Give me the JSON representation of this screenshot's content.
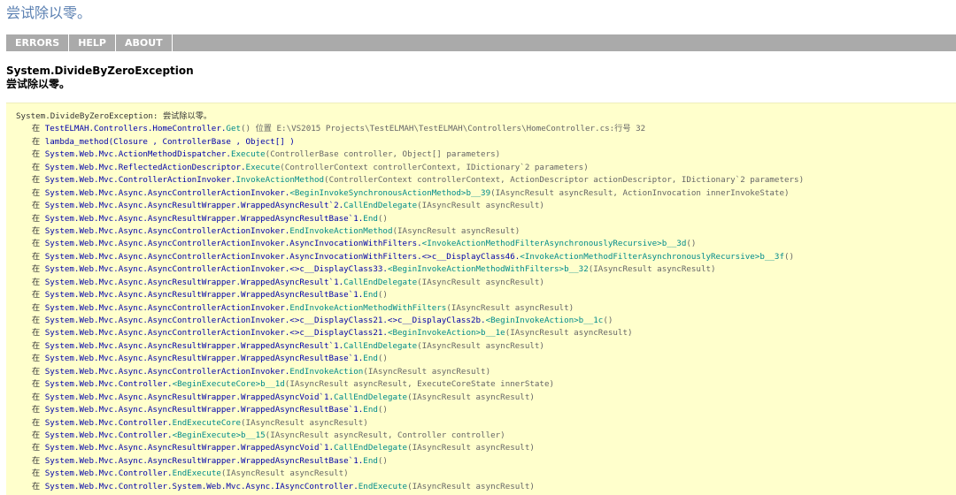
{
  "page": {
    "title": "尝试除以零。"
  },
  "nav": {
    "items": [
      "ERRORS",
      "HELP",
      "ABOUT"
    ]
  },
  "error": {
    "type": "System.DivideByZeroException",
    "message": "尝试除以零。"
  },
  "stack": {
    "first_line": "System.DivideByZeroException: 尝试除以零。",
    "at_word": "在",
    "frames": [
      {
        "cls": "TestELMAH.Controllers.HomeController.",
        "method": "Get",
        "args": "() 位置 E:\\VS2015 Projects\\TestELMAH\\TestELMAH\\Controllers\\HomeController.cs:行号 32"
      },
      {
        "cls": "lambda_method(Closure , ControllerBase , Object[] )",
        "method": "",
        "args": ""
      },
      {
        "cls": "System.Web.Mvc.ActionMethodDispatcher.",
        "method": "Execute",
        "args": "(ControllerBase controller, Object[] parameters)"
      },
      {
        "cls": "System.Web.Mvc.ReflectedActionDescriptor.",
        "method": "Execute",
        "args": "(ControllerContext controllerContext, IDictionary`2 parameters)"
      },
      {
        "cls": "System.Web.Mvc.ControllerActionInvoker.",
        "method": "InvokeActionMethod",
        "args": "(ControllerContext controllerContext, ActionDescriptor actionDescriptor, IDictionary`2 parameters)"
      },
      {
        "cls": "System.Web.Mvc.Async.AsyncControllerActionInvoker.",
        "method": "<BeginInvokeSynchronousActionMethod>b__39",
        "args": "(IAsyncResult asyncResult, ActionInvocation innerInvokeState)"
      },
      {
        "cls": "System.Web.Mvc.Async.AsyncResultWrapper.WrappedAsyncResult`2.",
        "method": "CallEndDelegate",
        "args": "(IAsyncResult asyncResult)"
      },
      {
        "cls": "System.Web.Mvc.Async.AsyncResultWrapper.WrappedAsyncResultBase`1.",
        "method": "End",
        "args": "()"
      },
      {
        "cls": "System.Web.Mvc.Async.AsyncControllerActionInvoker.",
        "method": "EndInvokeActionMethod",
        "args": "(IAsyncResult asyncResult)"
      },
      {
        "cls": "System.Web.Mvc.Async.AsyncControllerActionInvoker.AsyncInvocationWithFilters.",
        "method": "<InvokeActionMethodFilterAsynchronouslyRecursive>b__3d",
        "args": "()"
      },
      {
        "cls": "System.Web.Mvc.Async.AsyncControllerActionInvoker.AsyncInvocationWithFilters.<>c__DisplayClass46.",
        "method": "<InvokeActionMethodFilterAsynchronouslyRecursive>b__3f",
        "args": "()"
      },
      {
        "cls": "System.Web.Mvc.Async.AsyncControllerActionInvoker.<>c__DisplayClass33.",
        "method": "<BeginInvokeActionMethodWithFilters>b__32",
        "args": "(IAsyncResult asyncResult)"
      },
      {
        "cls": "System.Web.Mvc.Async.AsyncResultWrapper.WrappedAsyncResult`1.",
        "method": "CallEndDelegate",
        "args": "(IAsyncResult asyncResult)"
      },
      {
        "cls": "System.Web.Mvc.Async.AsyncResultWrapper.WrappedAsyncResultBase`1.",
        "method": "End",
        "args": "()"
      },
      {
        "cls": "System.Web.Mvc.Async.AsyncControllerActionInvoker.",
        "method": "EndInvokeActionMethodWithFilters",
        "args": "(IAsyncResult asyncResult)"
      },
      {
        "cls": "System.Web.Mvc.Async.AsyncControllerActionInvoker.<>c__DisplayClass21.<>c__DisplayClass2b.",
        "method": "<BeginInvokeAction>b__1c",
        "args": "()"
      },
      {
        "cls": "System.Web.Mvc.Async.AsyncControllerActionInvoker.<>c__DisplayClass21.",
        "method": "<BeginInvokeAction>b__1e",
        "args": "(IAsyncResult asyncResult)"
      },
      {
        "cls": "System.Web.Mvc.Async.AsyncResultWrapper.WrappedAsyncResult`1.",
        "method": "CallEndDelegate",
        "args": "(IAsyncResult asyncResult)"
      },
      {
        "cls": "System.Web.Mvc.Async.AsyncResultWrapper.WrappedAsyncResultBase`1.",
        "method": "End",
        "args": "()"
      },
      {
        "cls": "System.Web.Mvc.Async.AsyncControllerActionInvoker.",
        "method": "EndInvokeAction",
        "args": "(IAsyncResult asyncResult)"
      },
      {
        "cls": "System.Web.Mvc.Controller.",
        "method": "<BeginExecuteCore>b__1d",
        "args": "(IAsyncResult asyncResult, ExecuteCoreState innerState)"
      },
      {
        "cls": "System.Web.Mvc.Async.AsyncResultWrapper.WrappedAsyncVoid`1.",
        "method": "CallEndDelegate",
        "args": "(IAsyncResult asyncResult)"
      },
      {
        "cls": "System.Web.Mvc.Async.AsyncResultWrapper.WrappedAsyncResultBase`1.",
        "method": "End",
        "args": "()"
      },
      {
        "cls": "System.Web.Mvc.Controller.",
        "method": "EndExecuteCore",
        "args": "(IAsyncResult asyncResult)"
      },
      {
        "cls": "System.Web.Mvc.Controller.",
        "method": "<BeginExecute>b__15",
        "args": "(IAsyncResult asyncResult, Controller controller)"
      },
      {
        "cls": "System.Web.Mvc.Async.AsyncResultWrapper.WrappedAsyncVoid`1.",
        "method": "CallEndDelegate",
        "args": "(IAsyncResult asyncResult)"
      },
      {
        "cls": "System.Web.Mvc.Async.AsyncResultWrapper.WrappedAsyncResultBase`1.",
        "method": "End",
        "args": "()"
      },
      {
        "cls": "System.Web.Mvc.Controller.",
        "method": "EndExecute",
        "args": "(IAsyncResult asyncResult)"
      },
      {
        "cls": "System.Web.Mvc.Controller.System.Web.Mvc.Async.IAsyncController.",
        "method": "EndExecute",
        "args": "(IAsyncResult asyncResult)"
      }
    ]
  },
  "colors": {
    "title": "#5b80b2",
    "nav_bg": "#aaaaaa",
    "detail_bg": "#ffffcc",
    "method": "#008b8b"
  }
}
